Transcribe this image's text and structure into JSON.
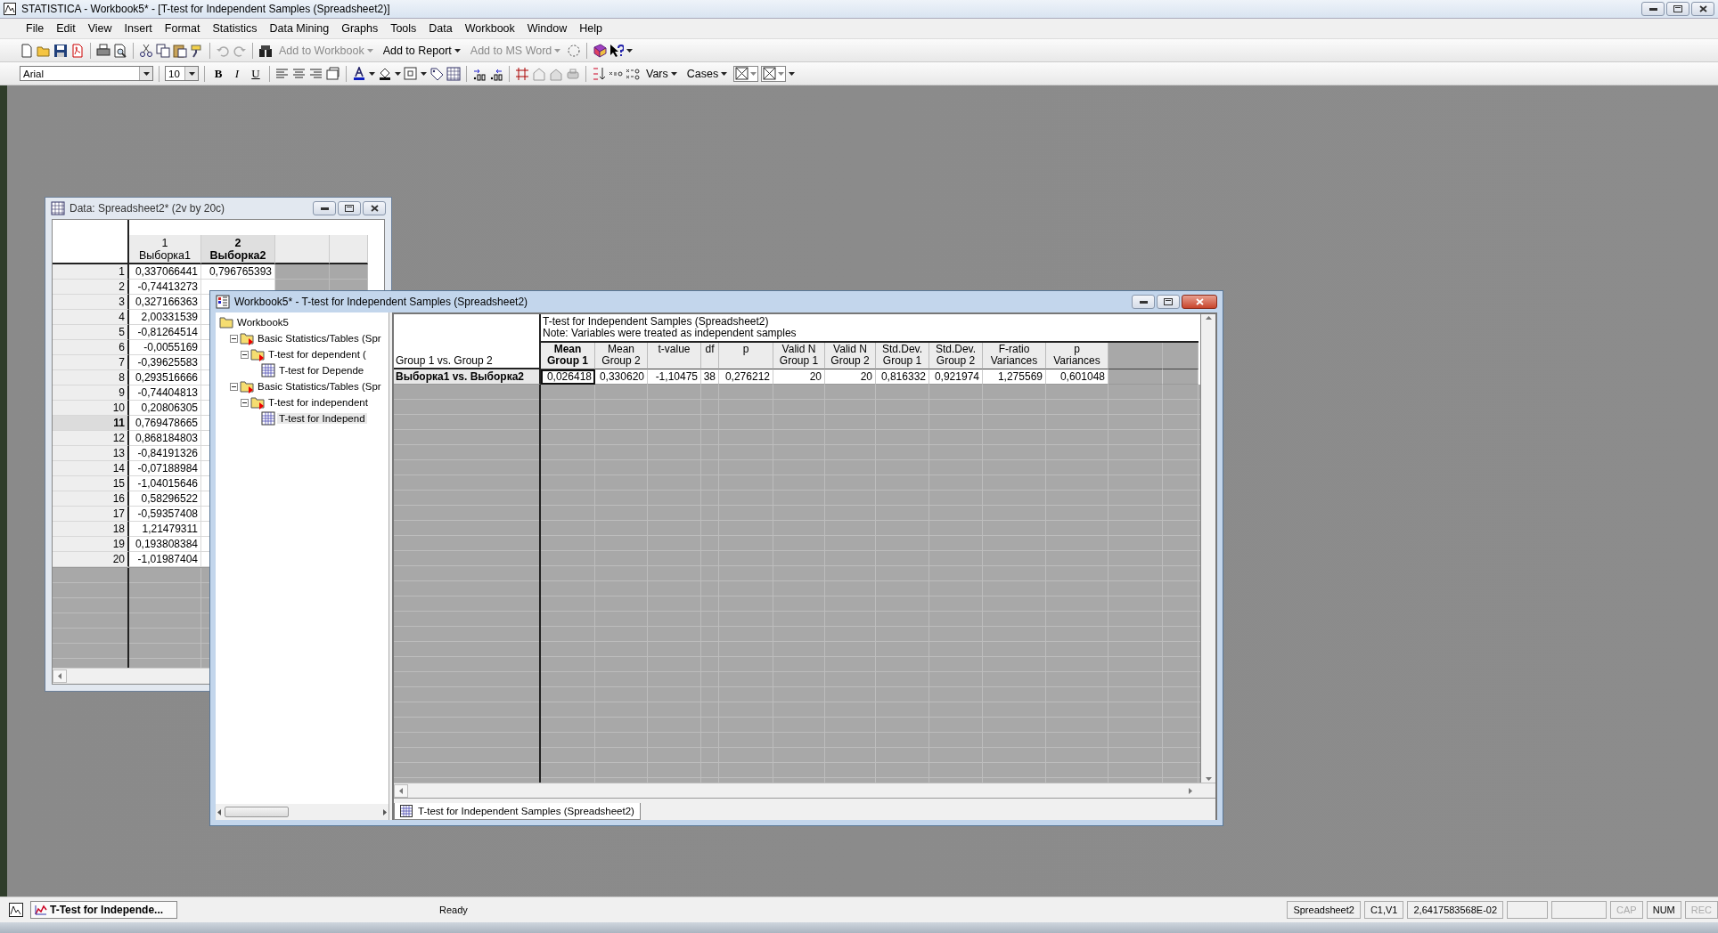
{
  "window": {
    "title": "STATISTICA - Workbook5* - [T-test for Independent Samples (Spreadsheet2)]"
  },
  "menu": [
    "File",
    "Edit",
    "View",
    "Insert",
    "Format",
    "Statistics",
    "Data Mining",
    "Graphs",
    "Tools",
    "Data",
    "Workbook",
    "Window",
    "Help"
  ],
  "standard_toolbar": {
    "buttons": [
      {
        "label": "Add to Workbook",
        "disabled": true
      },
      {
        "label": "Add to Report",
        "disabled": false
      },
      {
        "label": "Add to MS Word",
        "disabled": true
      }
    ]
  },
  "format_toolbar": {
    "font": "Arial",
    "size": "10",
    "styles": [
      {
        "label": "B",
        "kind": "bold"
      },
      {
        "label": "I",
        "kind": "italic"
      },
      {
        "label": "U",
        "kind": "underline"
      }
    ],
    "menus": [
      {
        "label": "Vars"
      },
      {
        "label": "Cases"
      }
    ]
  },
  "data_window": {
    "title": "Data: Spreadsheet2* (2v by 20c)",
    "columns": [
      {
        "number": "1",
        "name": "Выборка1",
        "selected": false
      },
      {
        "number": "2",
        "name": "Выборка2",
        "selected": true
      }
    ],
    "rows": [
      {
        "label": "1",
        "selected": false,
        "values": [
          "0,337066441",
          "0,796765393"
        ]
      },
      {
        "label": "2",
        "selected": false,
        "values": [
          "-0,74413273"
        ]
      },
      {
        "label": "3",
        "selected": false,
        "values": [
          "0,327166363"
        ]
      },
      {
        "label": "4",
        "selected": false,
        "values": [
          "2,00331539"
        ]
      },
      {
        "label": "5",
        "selected": false,
        "values": [
          "-0,81264514"
        ]
      },
      {
        "label": "6",
        "selected": false,
        "values": [
          "-0,0055169"
        ]
      },
      {
        "label": "7",
        "selected": false,
        "values": [
          "-0,39625583"
        ]
      },
      {
        "label": "8",
        "selected": false,
        "values": [
          "0,293516666"
        ]
      },
      {
        "label": "9",
        "selected": false,
        "values": [
          "-0,74404813"
        ]
      },
      {
        "label": "10",
        "selected": false,
        "values": [
          "0,20806305"
        ]
      },
      {
        "label": "11",
        "selected": true,
        "values": [
          "0,769478665"
        ]
      },
      {
        "label": "12",
        "selected": false,
        "values": [
          "0,868184803"
        ]
      },
      {
        "label": "13",
        "selected": false,
        "values": [
          "-0,84191326"
        ]
      },
      {
        "label": "14",
        "selected": false,
        "values": [
          "-0,07188984"
        ]
      },
      {
        "label": "15",
        "selected": false,
        "values": [
          "-1,04015646"
        ]
      },
      {
        "label": "16",
        "selected": false,
        "values": [
          "0,58296522"
        ]
      },
      {
        "label": "17",
        "selected": false,
        "values": [
          "-0,59357408"
        ]
      },
      {
        "label": "18",
        "selected": false,
        "values": [
          "1,21479311"
        ]
      },
      {
        "label": "19",
        "selected": false,
        "values": [
          "0,193808384"
        ]
      },
      {
        "label": "20",
        "selected": false,
        "values": [
          "-1,01987404"
        ]
      }
    ]
  },
  "workbook_window": {
    "title": "Workbook5* - T-test for Independent Samples (Spreadsheet2)",
    "tree": [
      {
        "label": "Workbook5",
        "kind": "workbook",
        "selected": false,
        "children": [
          {
            "label": "Basic Statistics/Tables (Spr",
            "kind": "analysis",
            "expanded": true,
            "selected": false,
            "children": [
              {
                "label": "T-test for dependent (",
                "kind": "analysis",
                "expanded": true,
                "selected": false,
                "children": [
                  {
                    "label": "T-test for Depende",
                    "kind": "sheet",
                    "expanded": false,
                    "selected": false
                  }
                ]
              }
            ]
          },
          {
            "label": "Basic Statistics/Tables (Spr",
            "kind": "analysis",
            "expanded": true,
            "selected": false,
            "children": [
              {
                "label": "T-test for independent",
                "kind": "analysis",
                "expanded": true,
                "selected": false,
                "children": [
                  {
                    "label": "T-test for Independ",
                    "kind": "sheet",
                    "expanded": false,
                    "selected": true
                  }
                ]
              }
            ]
          }
        ]
      }
    ],
    "results": {
      "title": "T-test for Independent Samples (Spreadsheet2)",
      "note": "Note: Variables were treated as independent samples",
      "group_header": "Group 1  vs. Group 2",
      "columns": [
        {
          "lines": [
            "Mean",
            "Group 1"
          ],
          "selected": true
        },
        {
          "lines": [
            "Mean",
            "Group 2"
          ],
          "selected": false
        },
        {
          "lines": [
            "t-value"
          ],
          "selected": false
        },
        {
          "lines": [
            "df"
          ],
          "selected": false
        },
        {
          "lines": [
            "p"
          ],
          "selected": false
        },
        {
          "lines": [
            "Valid N",
            "Group 1"
          ],
          "selected": false
        },
        {
          "lines": [
            "Valid N",
            "Group 2"
          ],
          "selected": false
        },
        {
          "lines": [
            "Std.Dev.",
            "Group 1"
          ],
          "selected": false
        },
        {
          "lines": [
            "Std.Dev.",
            "Group 2"
          ],
          "selected": false
        },
        {
          "lines": [
            "F-ratio",
            "Variances"
          ],
          "selected": false
        },
        {
          "lines": [
            "p",
            "Variances"
          ],
          "selected": false
        }
      ],
      "rows": [
        {
          "label": "Выборка1 vs. Выборка2",
          "values": [
            "0,026418",
            "0,330620",
            "-1,10475",
            "38",
            "0,276212",
            "20",
            "20",
            "0,816332",
            "0,921974",
            "1,275569",
            "0,601048"
          ]
        }
      ]
    },
    "sheet_tab": {
      "label": "T-test for Independent Samples (Spreadsheet2)",
      "selected": true
    }
  },
  "status_bar": {
    "task_button": "T-Test for Independe...",
    "message": "Ready",
    "panels": [
      "Spreadsheet2",
      "C1,V1",
      "2,6417583568E-02"
    ],
    "indicators": [
      {
        "label": "CAP",
        "on": false
      },
      {
        "label": "NUM",
        "on": true
      },
      {
        "label": "REC",
        "on": false
      }
    ]
  }
}
